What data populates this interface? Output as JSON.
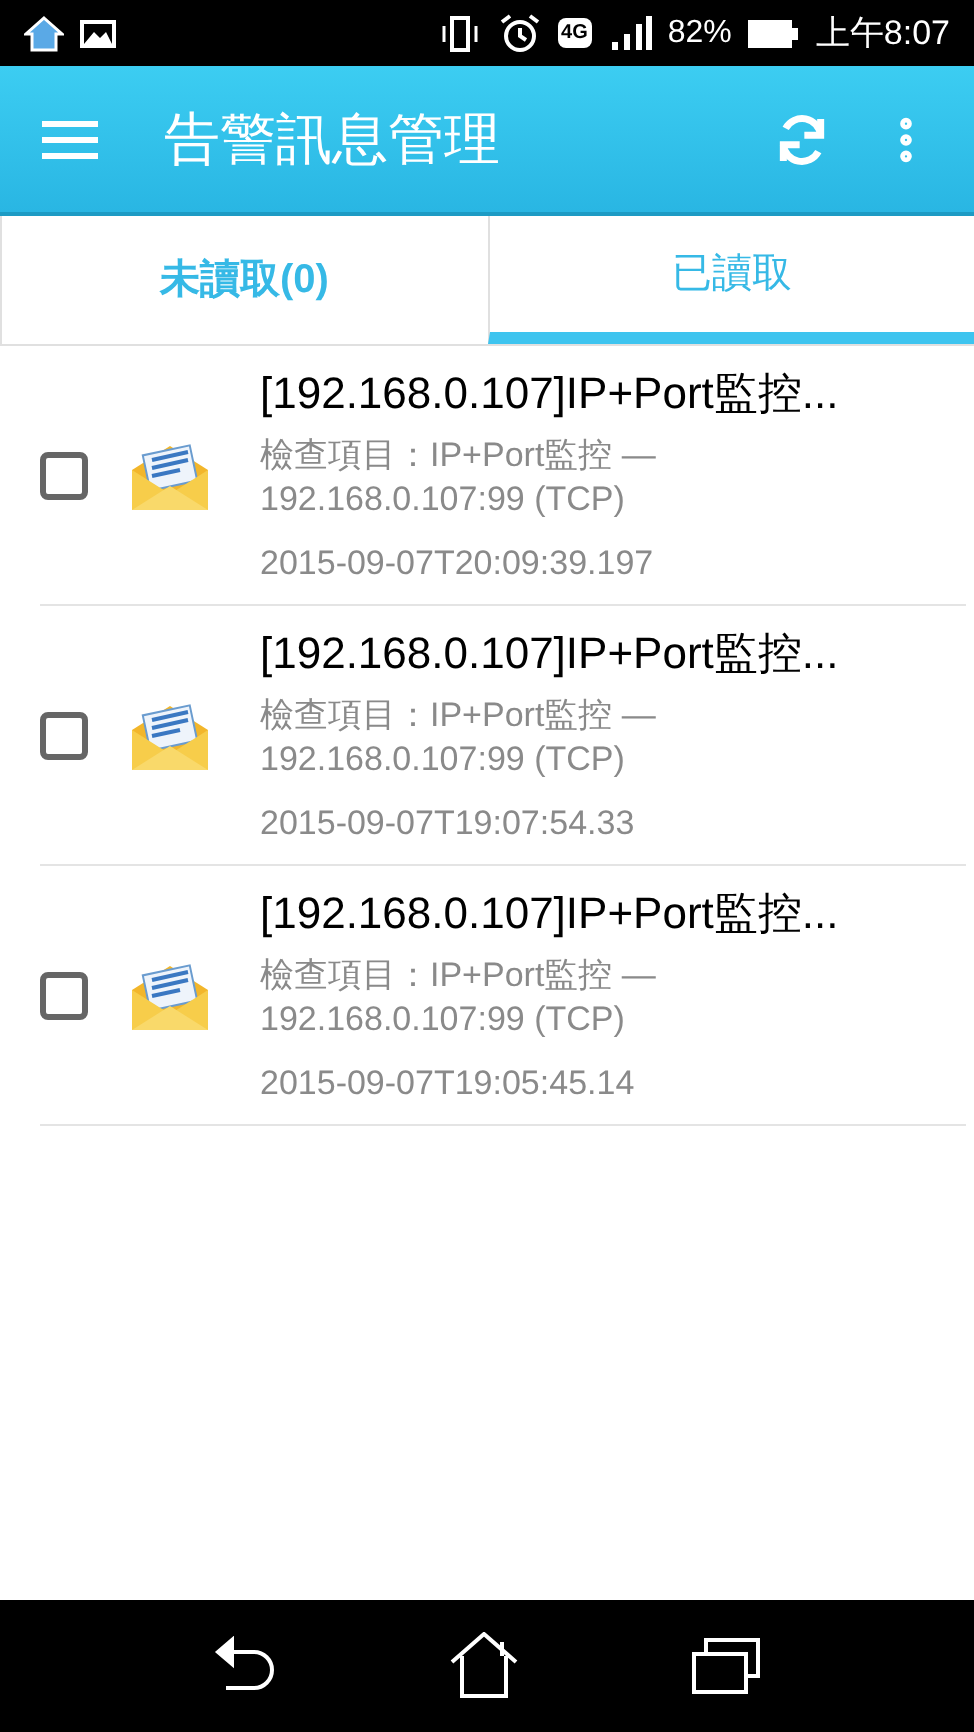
{
  "status_bar": {
    "network": "4G",
    "battery": "82%",
    "time": "上午8:07"
  },
  "app_bar": {
    "title": "告警訊息管理"
  },
  "tabs": [
    {
      "label": "未讀取(0)",
      "selected": false
    },
    {
      "label": "已讀取",
      "selected": true
    }
  ],
  "messages": [
    {
      "title": "[192.168.0.107]IP+Port監控...",
      "detail": "檢查項目：IP+Port監控 — 192.168.0.107:99 (TCP)",
      "time": "2015-09-07T20:09:39.197",
      "checked": false
    },
    {
      "title": "[192.168.0.107]IP+Port監控...",
      "detail": "檢查項目：IP+Port監控 — 192.168.0.107:99 (TCP)",
      "time": "2015-09-07T19:07:54.33",
      "checked": false
    },
    {
      "title": "[192.168.0.107]IP+Port監控...",
      "detail": "檢查項目：IP+Port監控 — 192.168.0.107:99 (TCP)",
      "time": "2015-09-07T19:05:45.14",
      "checked": false
    }
  ]
}
